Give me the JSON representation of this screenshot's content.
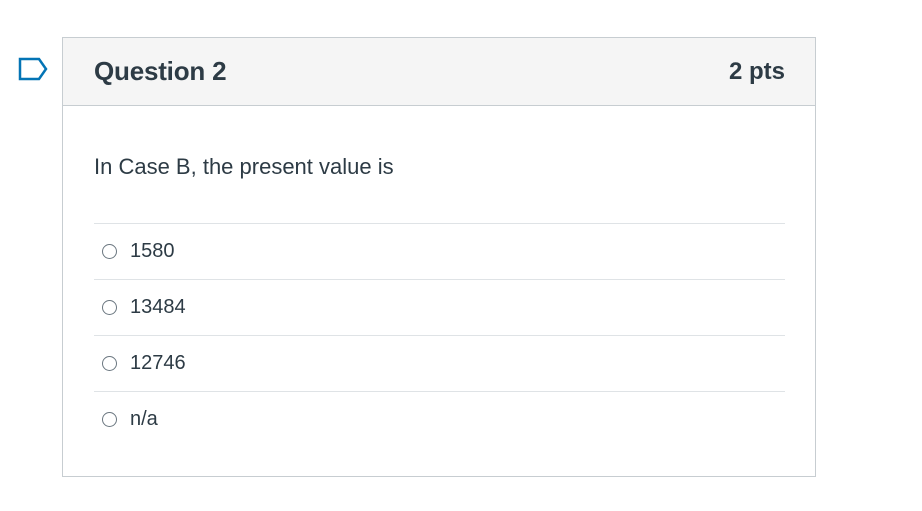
{
  "question": {
    "title": "Question 2",
    "points": "2 pts",
    "text": "In Case B, the present value is",
    "answers": [
      {
        "label": "1580",
        "selected": false
      },
      {
        "label": "13484",
        "selected": false
      },
      {
        "label": "12746",
        "selected": false
      },
      {
        "label": "n/a",
        "selected": false
      }
    ]
  },
  "icons": {
    "flag": "flag-question-icon"
  },
  "colors": {
    "flag_accent": "#0374b5",
    "header_bg": "#f5f5f5",
    "border": "#c7cdd1",
    "text": "#2d3b45"
  }
}
